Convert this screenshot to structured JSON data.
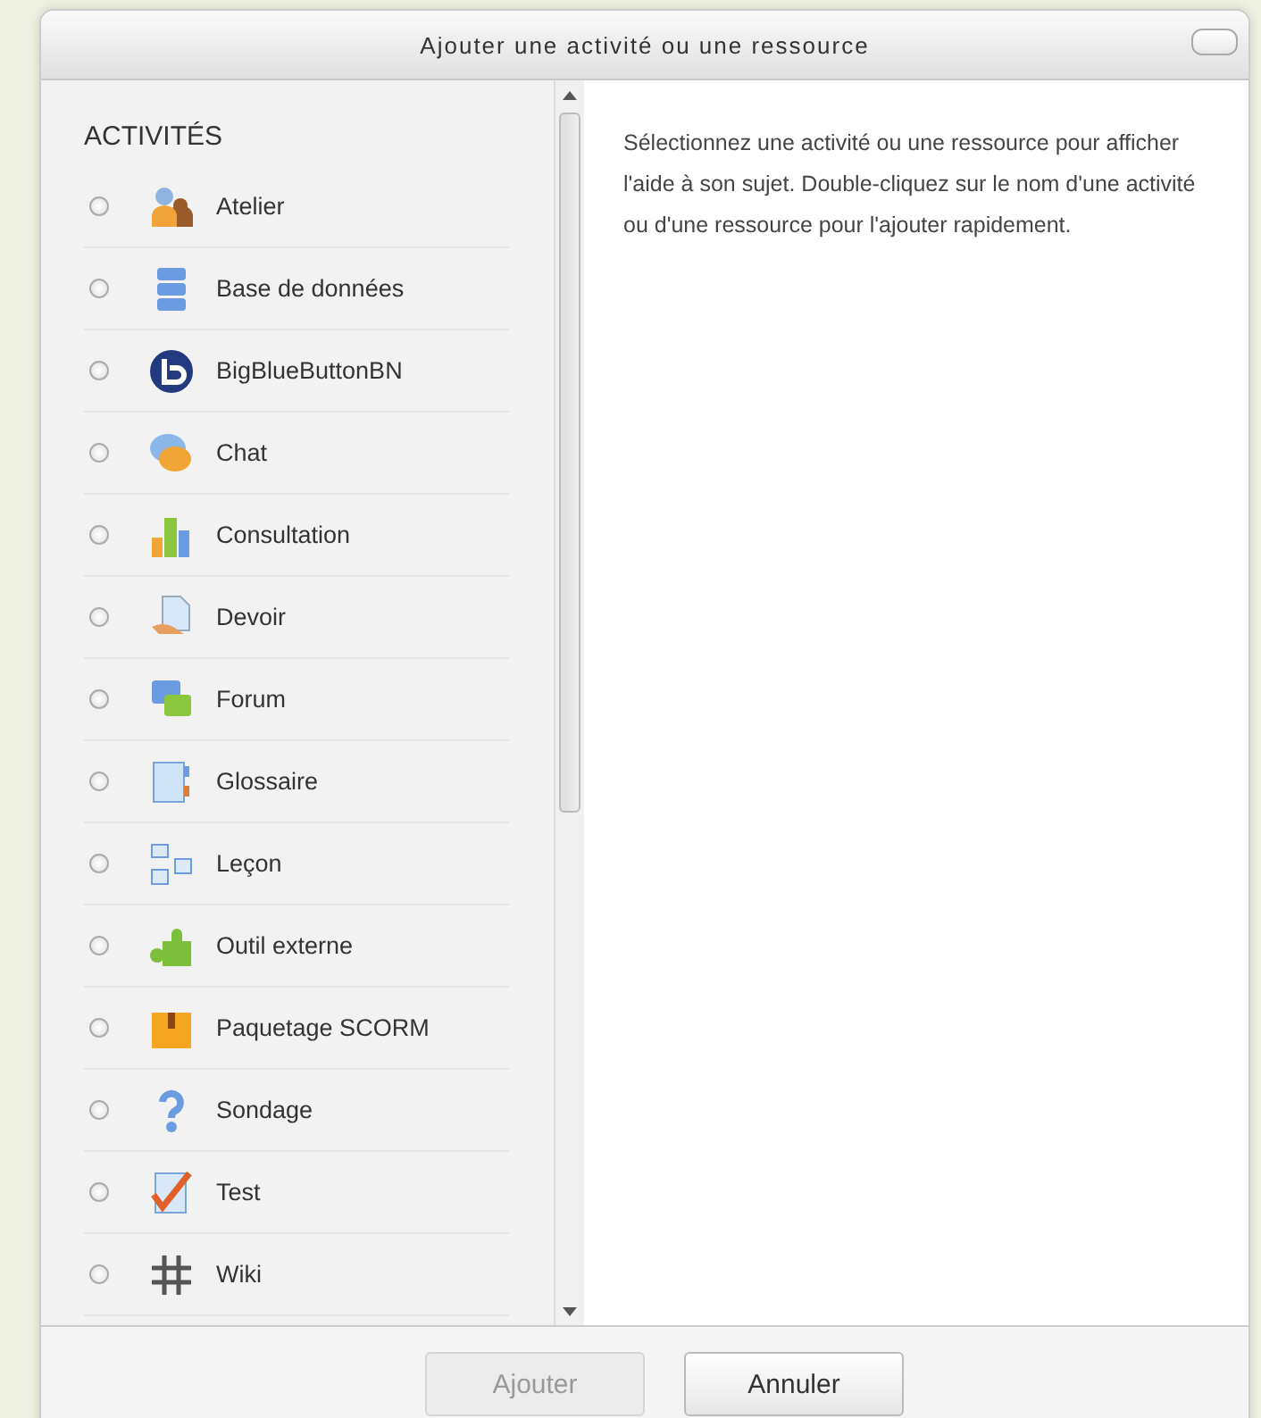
{
  "dialog": {
    "title": "Ajouter une activité ou une ressource"
  },
  "list": {
    "heading": "ACTIVITÉS",
    "items": [
      {
        "label": "Atelier",
        "selected": false
      },
      {
        "label": "Base de données",
        "selected": false
      },
      {
        "label": "BigBlueButtonBN",
        "selected": false
      },
      {
        "label": "Chat",
        "selected": false
      },
      {
        "label": "Consultation",
        "selected": false
      },
      {
        "label": "Devoir",
        "selected": false
      },
      {
        "label": "Forum",
        "selected": false
      },
      {
        "label": "Glossaire",
        "selected": false
      },
      {
        "label": "Leçon",
        "selected": false
      },
      {
        "label": "Outil externe",
        "selected": false
      },
      {
        "label": "Paquetage SCORM",
        "selected": false
      },
      {
        "label": "Sondage",
        "selected": false
      },
      {
        "label": "Test",
        "selected": false
      },
      {
        "label": "Wiki",
        "selected": false
      }
    ]
  },
  "help_text": "Sélectionnez une activité ou une ressource pour afficher l'aide à son sujet. Double-cliquez sur le nom d'une activité ou d'une ressource pour l'ajouter rapidement.",
  "buttons": [
    {
      "label": "Ajouter",
      "disabled": true
    },
    {
      "label": "Annuler",
      "disabled": false
    }
  ]
}
